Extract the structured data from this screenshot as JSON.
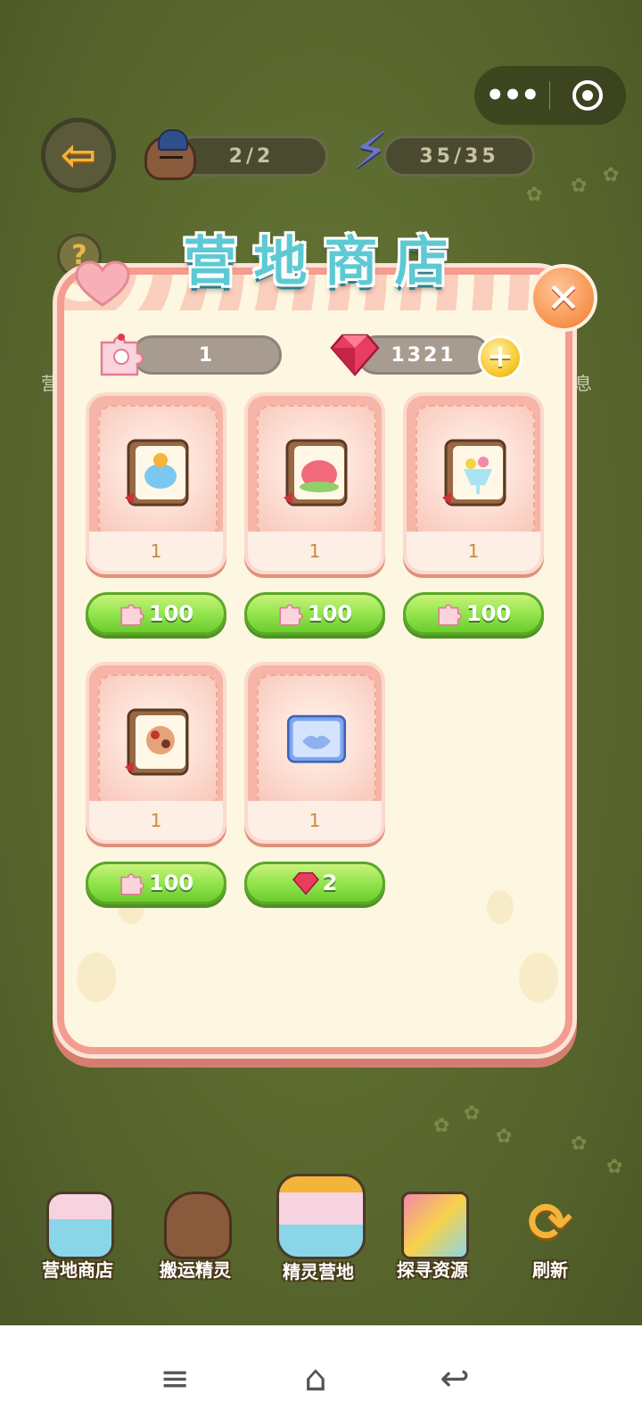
{
  "topbar": {
    "more_icon": "more-dots-icon",
    "close_icon": "target-circle-icon"
  },
  "header": {
    "workers": "2/2",
    "energy": "35/35"
  },
  "side_labels": {
    "left": "营",
    "right": "息"
  },
  "shop": {
    "title_chars": [
      "营",
      "地",
      "商",
      "店"
    ],
    "puzzle_count": "1",
    "gem_count": "1321",
    "items": [
      {
        "count": "1",
        "price": "100",
        "currency": "puzzle",
        "art": "ice-cream-cake-card"
      },
      {
        "count": "1",
        "price": "100",
        "currency": "puzzle",
        "art": "strawberry-jelly-card"
      },
      {
        "count": "1",
        "price": "100",
        "currency": "puzzle",
        "art": "fruit-parfait-card"
      },
      {
        "count": "1",
        "price": "100",
        "currency": "puzzle",
        "art": "pastry-platter-card"
      },
      {
        "count": "1",
        "price": "2",
        "currency": "gem",
        "art": "handshake-ticket"
      }
    ]
  },
  "nav": [
    {
      "label": "营地商店",
      "icon": "shop-stall-icon"
    },
    {
      "label": "搬运精灵",
      "icon": "porter-sprite-icon"
    },
    {
      "label": "精灵营地",
      "icon": "sprite-camp-icon"
    },
    {
      "label": "探寻资源",
      "icon": "explore-resources-icon"
    },
    {
      "label": "刷新",
      "icon": "refresh-icon"
    }
  ],
  "colors": {
    "panel_border": "#f39c8f",
    "panel_bg": "#fdf6e0",
    "price_button": "#8ee34a",
    "title": "#5dc9d3"
  }
}
